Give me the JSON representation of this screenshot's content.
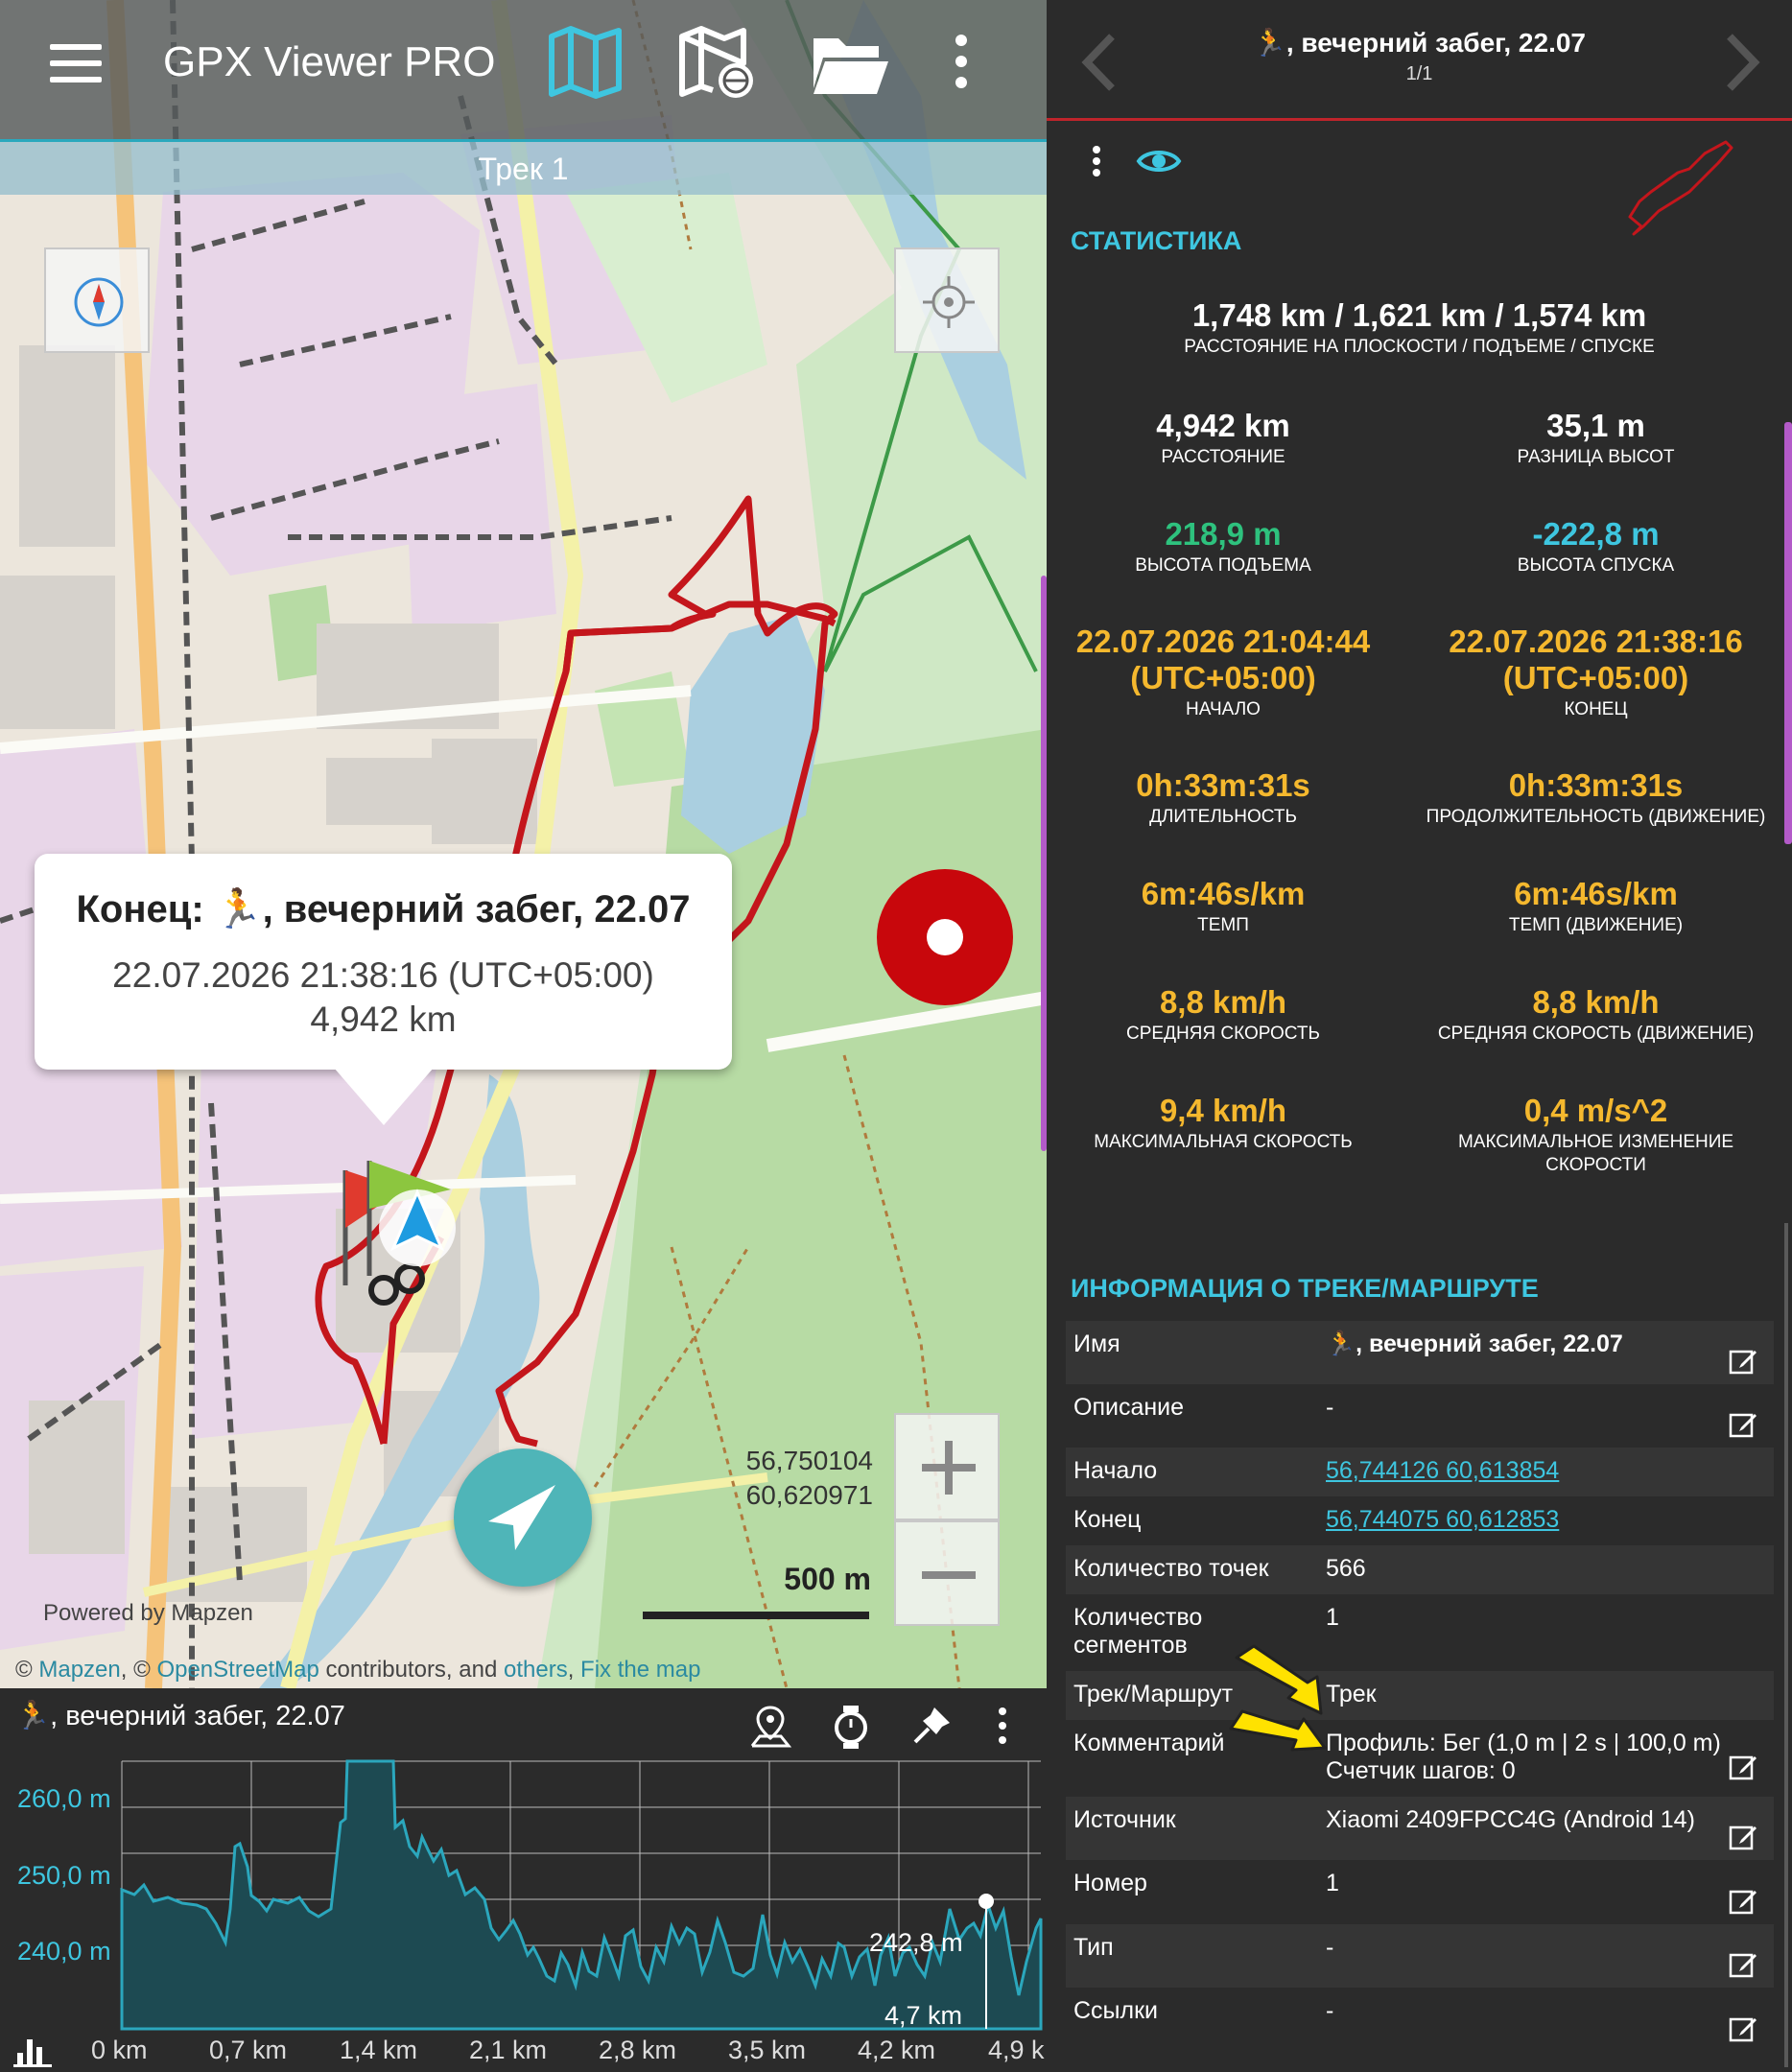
{
  "toolbar": {
    "title": "GPX Viewer PRO",
    "subtitle": "Трек 1"
  },
  "map": {
    "callout_title": "Конец: 🏃, вечерний забег, 22.07",
    "callout_time": "22.07.2026 21:38:16 (UTC+05:00)",
    "callout_distance": "4,942 km",
    "coord_lat": "56,750104",
    "coord_lon": "60,620971",
    "scale_label": "500 m",
    "powered": "Powered by Mapzen",
    "attribution": {
      "prefix": "© ",
      "mapzen": "Mapzen",
      "sep1": ", © ",
      "osm": "OpenStreetMap",
      "mid": " contributors, and ",
      "others": "others",
      "sep2": ", ",
      "fix": "Fix the map"
    },
    "route_color": "#c4161c"
  },
  "elevation": {
    "title": "🏃, вечерний забег, 22.07",
    "y_labels": [
      "260,0 m",
      "250,0 m",
      "240,0 m"
    ],
    "x_labels": [
      "0 km",
      "0,7 km",
      "1,4 km",
      "2,1 km",
      "2,8 km",
      "3,5 km",
      "4,2 km",
      "4,9 k"
    ],
    "marker_value": "242,8 m",
    "marker_distance": "4,7 km"
  },
  "details": {
    "header_title": "🏃, вечерний забег, 22.07",
    "header_page": "1/1",
    "stats_heading": "СТАТИСТИКА",
    "top_stat": {
      "value": "1,748 km / 1,621 km / 1,574 km",
      "label": "РАССТОЯНИЕ НА ПЛОСКОСТИ / ПОДЪЕМЕ / СПУСКЕ"
    },
    "stats": [
      {
        "value": "4,942 km",
        "label": "РАССТОЯНИЕ",
        "color": "#ffffff"
      },
      {
        "value": "35,1 m",
        "label": "РАЗНИЦА ВЫСОТ",
        "color": "#ffffff"
      },
      {
        "value": "218,9 m",
        "label": "ВЫСОТА ПОДЪЕМА",
        "color": "#2ec27e"
      },
      {
        "value": "-222,8 m",
        "label": "ВЫСОТА СПУСКА",
        "color": "#3ec6e0"
      },
      {
        "value": "22.07.2026 21:04:44\n(UTC+05:00)",
        "label": "НАЧАЛО",
        "color": "#f5b82e"
      },
      {
        "value": "22.07.2026 21:38:16\n(UTC+05:00)",
        "label": "КОНЕЦ",
        "color": "#f5b82e"
      },
      {
        "value": "0h:33m:31s",
        "label": "ДЛИТЕЛЬНОСТЬ",
        "color": "#f5b82e"
      },
      {
        "value": "0h:33m:31s",
        "label": "ПРОДОЛЖИТЕЛЬНОСТЬ (ДВИЖЕНИЕ)",
        "color": "#f5b82e"
      },
      {
        "value": "6m:46s/km",
        "label": "ТЕМП",
        "color": "#f5b82e"
      },
      {
        "value": "6m:46s/km",
        "label": "ТЕМП (ДВИЖЕНИЕ)",
        "color": "#f5b82e"
      },
      {
        "value": "8,8 km/h",
        "label": "СРЕДНЯЯ СКОРОСТЬ",
        "color": "#f5b82e"
      },
      {
        "value": "8,8 km/h",
        "label": "СРЕДНЯЯ СКОРОСТЬ (ДВИЖЕНИЕ)",
        "color": "#f5b82e"
      },
      {
        "value": "9,4 km/h",
        "label": "МАКСИМАЛЬНАЯ СКОРОСТЬ",
        "color": "#f5b82e"
      },
      {
        "value": "0,4 m/s^2",
        "label": "МАКСИМАЛЬНОЕ ИЗМЕНЕНИЕ\nСКОРОСТИ",
        "color": "#f5b82e"
      }
    ],
    "info_heading": "ИНФОРМАЦИЯ О ТРЕКЕ/МАРШРУТЕ",
    "info_rows": [
      {
        "key": "Имя",
        "value": "🏃, вечерний забег, 22.07"
      },
      {
        "key": "Описание",
        "value": "-"
      },
      {
        "key": "Начало",
        "value": "56,744126 60,613854"
      },
      {
        "key": "Конец",
        "value": "56,744075 60,612853"
      },
      {
        "key": "Количество точек",
        "value": "566"
      },
      {
        "key": "Количество\nсегментов",
        "value": "1"
      },
      {
        "key": "Трек/Маршрут",
        "value": "Трек"
      },
      {
        "key": "Комментарий",
        "value": "Профиль: Бег (1,0 m | 2 s | 100,0 m)\nСчетчик шагов: 0"
      },
      {
        "key": "Источник",
        "value": "Xiaomi 2409FPCC4G (Android 14)"
      },
      {
        "key": "Номер",
        "value": "1"
      },
      {
        "key": "Тип",
        "value": "-"
      },
      {
        "key": "Ссылки",
        "value": "-"
      }
    ]
  },
  "colors": {
    "accent": "#3ec6e0",
    "route": "#c4161c",
    "record": "#c8070c",
    "nav_button": "#4fb5b8",
    "annotation_arrow": "#ffe200"
  },
  "icons": [
    "menu-icon",
    "map-icon",
    "map-globe-icon",
    "folder-icon",
    "overflow-icon",
    "compass-icon",
    "locate-icon",
    "record-icon",
    "navigate-icon",
    "zoom-in-icon",
    "zoom-out-icon",
    "chart-icon",
    "waypoint-icon",
    "clock-icon",
    "pin-icon",
    "eye-icon",
    "edit-icon",
    "chevron-left-icon",
    "chevron-right-icon"
  ]
}
